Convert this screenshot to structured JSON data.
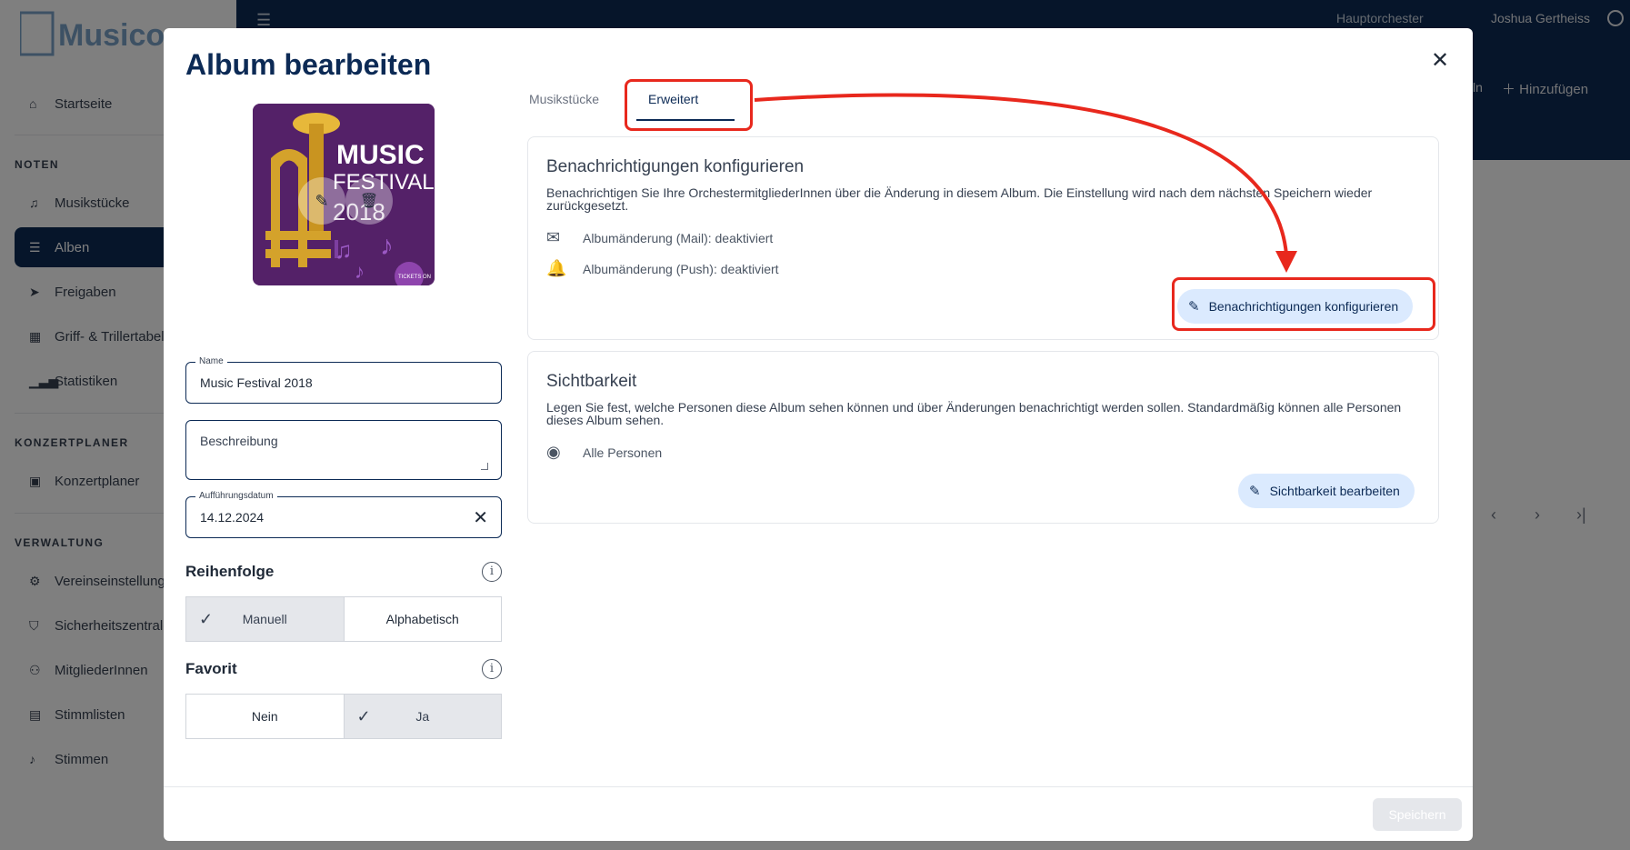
{
  "app": {
    "logo_text": "Musicorum",
    "topbar": {
      "orchestra": "Hauptorchester",
      "user": "Joshua Gertheiss"
    },
    "content_header": {
      "filter_fragment": "ln",
      "add_label": "Hinzufügen"
    },
    "sidebar": {
      "home": "Startseite",
      "sections": [
        {
          "title": "NOTEN",
          "items": [
            "Musikstücke",
            "Alben",
            "Freigaben",
            "Griff- & Trillertabelle",
            "Statistiken"
          ]
        },
        {
          "title": "KONZERTPLANER",
          "items": [
            "Konzertplaner"
          ]
        },
        {
          "title": "VERWALTUNG",
          "items": [
            "Vereinseinstellungen",
            "Sicherheitszentrale",
            "MitgliederInnen",
            "Stimmlisten",
            "Stimmen"
          ]
        }
      ],
      "active_item": "Alben"
    }
  },
  "modal": {
    "title": "Album bearbeiten",
    "cover": {
      "line1": "MUSIC",
      "line2": "FESTIVAL",
      "line3": "2018",
      "badge": "TICKETS ON"
    },
    "name_field": {
      "label": "Name",
      "value": "Music Festival 2018"
    },
    "description_field": {
      "placeholder": "Beschreibung"
    },
    "date_field": {
      "label": "Aufführungsdatum",
      "value": "14.12.2024"
    },
    "order": {
      "title": "Reihenfolge",
      "options": [
        "Manuell",
        "Alphabetisch"
      ],
      "selected": "Manuell"
    },
    "favorite": {
      "title": "Favorit",
      "options": [
        "Nein",
        "Ja"
      ],
      "selected": "Ja"
    },
    "tabs": [
      "Musikstücke",
      "Erweitert"
    ],
    "active_tab": "Erweitert",
    "notifications": {
      "title": "Benachrichtigungen konfigurieren",
      "description_line1": "Benachrichtigen Sie Ihre OrchestermitgliederInnen über die Änderung in diesem Album. Die Einstellung wird nach dem nächsten Speichern wieder",
      "description_line2": "zurückgesetzt.",
      "mail": "Albumänderung (Mail): deaktiviert",
      "push": "Albumänderung (Push): deaktiviert",
      "button": "Benachrichtigungen konfigurieren"
    },
    "visibility": {
      "title": "Sichtbarkeit",
      "description_line1": "Legen Sie fest, welche Personen diese Album sehen können und über Änderungen benachrichtigt werden sollen. Standardmäßig können alle Personen",
      "description_line2": "dieses Album sehen.",
      "audience": "Alle Personen",
      "button": "Sichtbarkeit bearbeiten"
    },
    "save_button": "Speichern"
  },
  "colors": {
    "brand_navy": "#0c2a55",
    "annotation_red": "#e8281d",
    "pill_bg": "#dbeafe"
  }
}
